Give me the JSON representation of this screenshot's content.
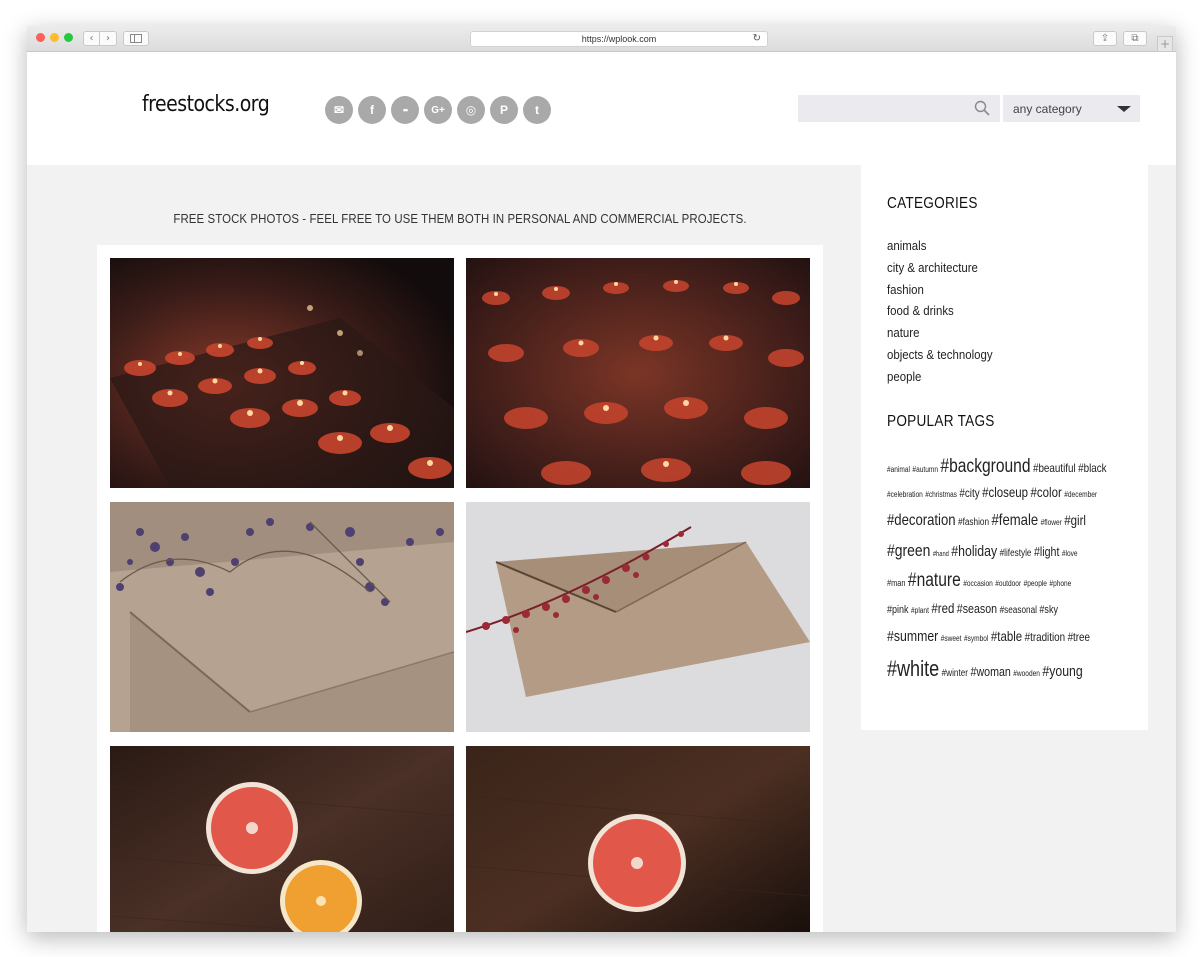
{
  "browser": {
    "url": "https://wplook.com",
    "back_glyph": "‹",
    "forward_glyph": "›",
    "reload_glyph": "↻",
    "share_glyph": "⇪",
    "tabs_glyph": "⧉",
    "newtab_glyph": "+"
  },
  "header": {
    "logo": "freestocks.org",
    "socials": [
      {
        "icon": "mail-icon",
        "glyph": "✉"
      },
      {
        "icon": "facebook-icon",
        "glyph": "f"
      },
      {
        "icon": "flickr-icon",
        "glyph": "••"
      },
      {
        "icon": "google-plus-icon",
        "glyph": "G+"
      },
      {
        "icon": "instagram-icon",
        "glyph": "◎"
      },
      {
        "icon": "pinterest-icon",
        "glyph": "P"
      },
      {
        "icon": "twitter-icon",
        "glyph": "t"
      }
    ],
    "search_placeholder": "",
    "category_selected": "any category"
  },
  "tagline": "FREE STOCK PHOTOS - FEEL FREE TO USE THEM BOTH IN PERSONAL AND COMMERCIAL PROJECTS.",
  "sidebar": {
    "categories_title": "CATEGORIES",
    "categories": [
      "animals",
      "city & architecture",
      "fashion",
      "food & drinks",
      "nature",
      "objects & technology",
      "people"
    ],
    "tags_title": "POPULAR TAGS",
    "tag_lines": [
      [
        [
          "#animal",
          8
        ],
        [
          "#autumn",
          8
        ],
        [
          "#background",
          19
        ],
        [
          "#beautiful",
          12
        ],
        [
          "#black",
          12
        ]
      ],
      [
        [
          "#celebration",
          8
        ],
        [
          "#christmas",
          8
        ],
        [
          "#city",
          12
        ],
        [
          "#closeup",
          14
        ],
        [
          "#color",
          14
        ],
        [
          "#december",
          8
        ]
      ],
      [
        [
          "#decoration",
          16
        ],
        [
          "#fashion",
          10
        ],
        [
          "#female",
          16
        ],
        [
          "#flower",
          8
        ],
        [
          "#girl",
          14
        ]
      ],
      [
        [
          "#green",
          17
        ],
        [
          "#hand",
          7
        ],
        [
          "#holiday",
          15
        ],
        [
          "#lifestyle",
          10
        ],
        [
          "#light",
          13
        ],
        [
          "#love",
          8
        ]
      ],
      [
        [
          "#man",
          9
        ],
        [
          "#nature",
          19
        ],
        [
          "#occasion",
          8
        ],
        [
          "#outdoor",
          8
        ],
        [
          "#people",
          8
        ],
        [
          "#phone",
          8
        ]
      ],
      [
        [
          "#pink",
          11
        ],
        [
          "#plant",
          8
        ],
        [
          "#red",
          14
        ],
        [
          "#season",
          13
        ],
        [
          "#seasonal",
          10
        ],
        [
          "#sky",
          11
        ]
      ],
      [
        [
          "#summer",
          15
        ],
        [
          "#sweet",
          8
        ],
        [
          "#symbol",
          8
        ],
        [
          "#table",
          14
        ],
        [
          "#tradition",
          12
        ],
        [
          "#tree",
          12
        ]
      ],
      [
        [
          "#white",
          22
        ],
        [
          "#winter",
          10
        ],
        [
          "#woman",
          13
        ],
        [
          "#wooden",
          8
        ],
        [
          "#young",
          15
        ]
      ]
    ]
  },
  "colors": {
    "accent_social": "#a9a9a9",
    "page_bg": "#f3f2f3"
  }
}
